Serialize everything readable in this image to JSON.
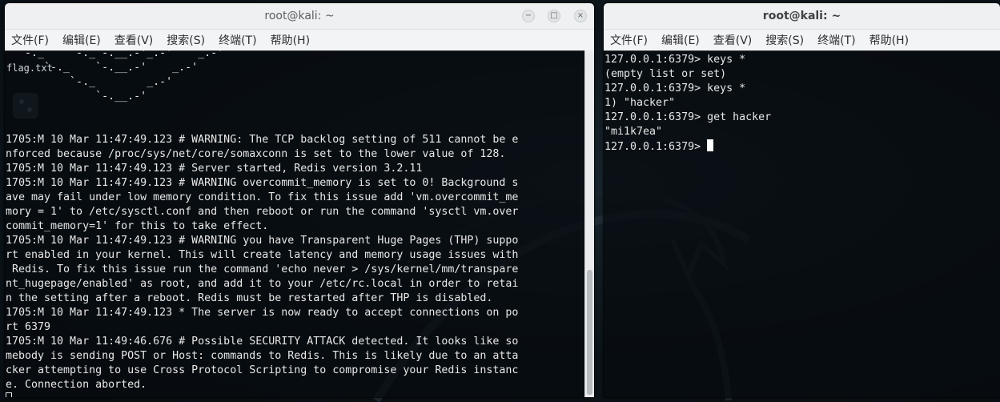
{
  "desktop": {
    "icon_labels": [
      "flag.txt"
    ],
    "accent": "#0b1217"
  },
  "left_window": {
    "title": "root@kali: ~",
    "controls": {
      "minimize": "−",
      "maximize": "□",
      "close": "×"
    },
    "menu": [
      "文件(F)",
      "编辑(E)",
      "查看(V)",
      "搜索(S)",
      "终端(T)",
      "帮助(H)"
    ],
    "lines": [
      "  `-._    `-._`-.__.-'_.-'    _.-'",
      "      `-._    `-.__.-'    _.-'",
      "          `-._        _.-'",
      "              `-.__.-'",
      "",
      "",
      "1705:M 10 Mar 11:47:49.123 # WARNING: The TCP backlog setting of 511 cannot be e",
      "nforced because /proc/sys/net/core/somaxconn is set to the lower value of 128.",
      "1705:M 10 Mar 11:47:49.123 # Server started, Redis version 3.2.11",
      "1705:M 10 Mar 11:47:49.123 # WARNING overcommit_memory is set to 0! Background s",
      "ave may fail under low memory condition. To fix this issue add 'vm.overcommit_me",
      "mory = 1' to /etc/sysctl.conf and then reboot or run the command 'sysctl vm.over",
      "commit_memory=1' for this to take effect.",
      "1705:M 10 Mar 11:47:49.123 # WARNING you have Transparent Huge Pages (THP) suppo",
      "rt enabled in your kernel. This will create latency and memory usage issues with",
      " Redis. To fix this issue run the command 'echo never > /sys/kernel/mm/transpare",
      "nt_hugepage/enabled' as root, and add it to your /etc/rc.local in order to retai",
      "n the setting after a reboot. Redis must be restarted after THP is disabled.",
      "1705:M 10 Mar 11:47:49.123 * The server is now ready to accept connections on po",
      "rt 6379",
      "1705:M 10 Mar 11:49:46.676 # Possible SECURITY ATTACK detected. It looks like so",
      "mebody is sending POST or Host: commands to Redis. This is likely due to an atta",
      "cker attempting to use Cross Protocol Scripting to compromise your Redis instanc",
      "e. Connection aborted."
    ]
  },
  "right_window": {
    "title": "root@kali: ~",
    "menu": [
      "文件(F)",
      "编辑(E)",
      "查看(V)",
      "搜索(S)",
      "终端(T)",
      "帮助(H)"
    ],
    "lines": [
      "127.0.0.1:6379> keys *",
      "(empty list or set)",
      "127.0.0.1:6379> keys *",
      "1) \"hacker\"",
      "127.0.0.1:6379> get hacker",
      "\"mi1k7ea\""
    ],
    "prompt": "127.0.0.1:6379> "
  }
}
